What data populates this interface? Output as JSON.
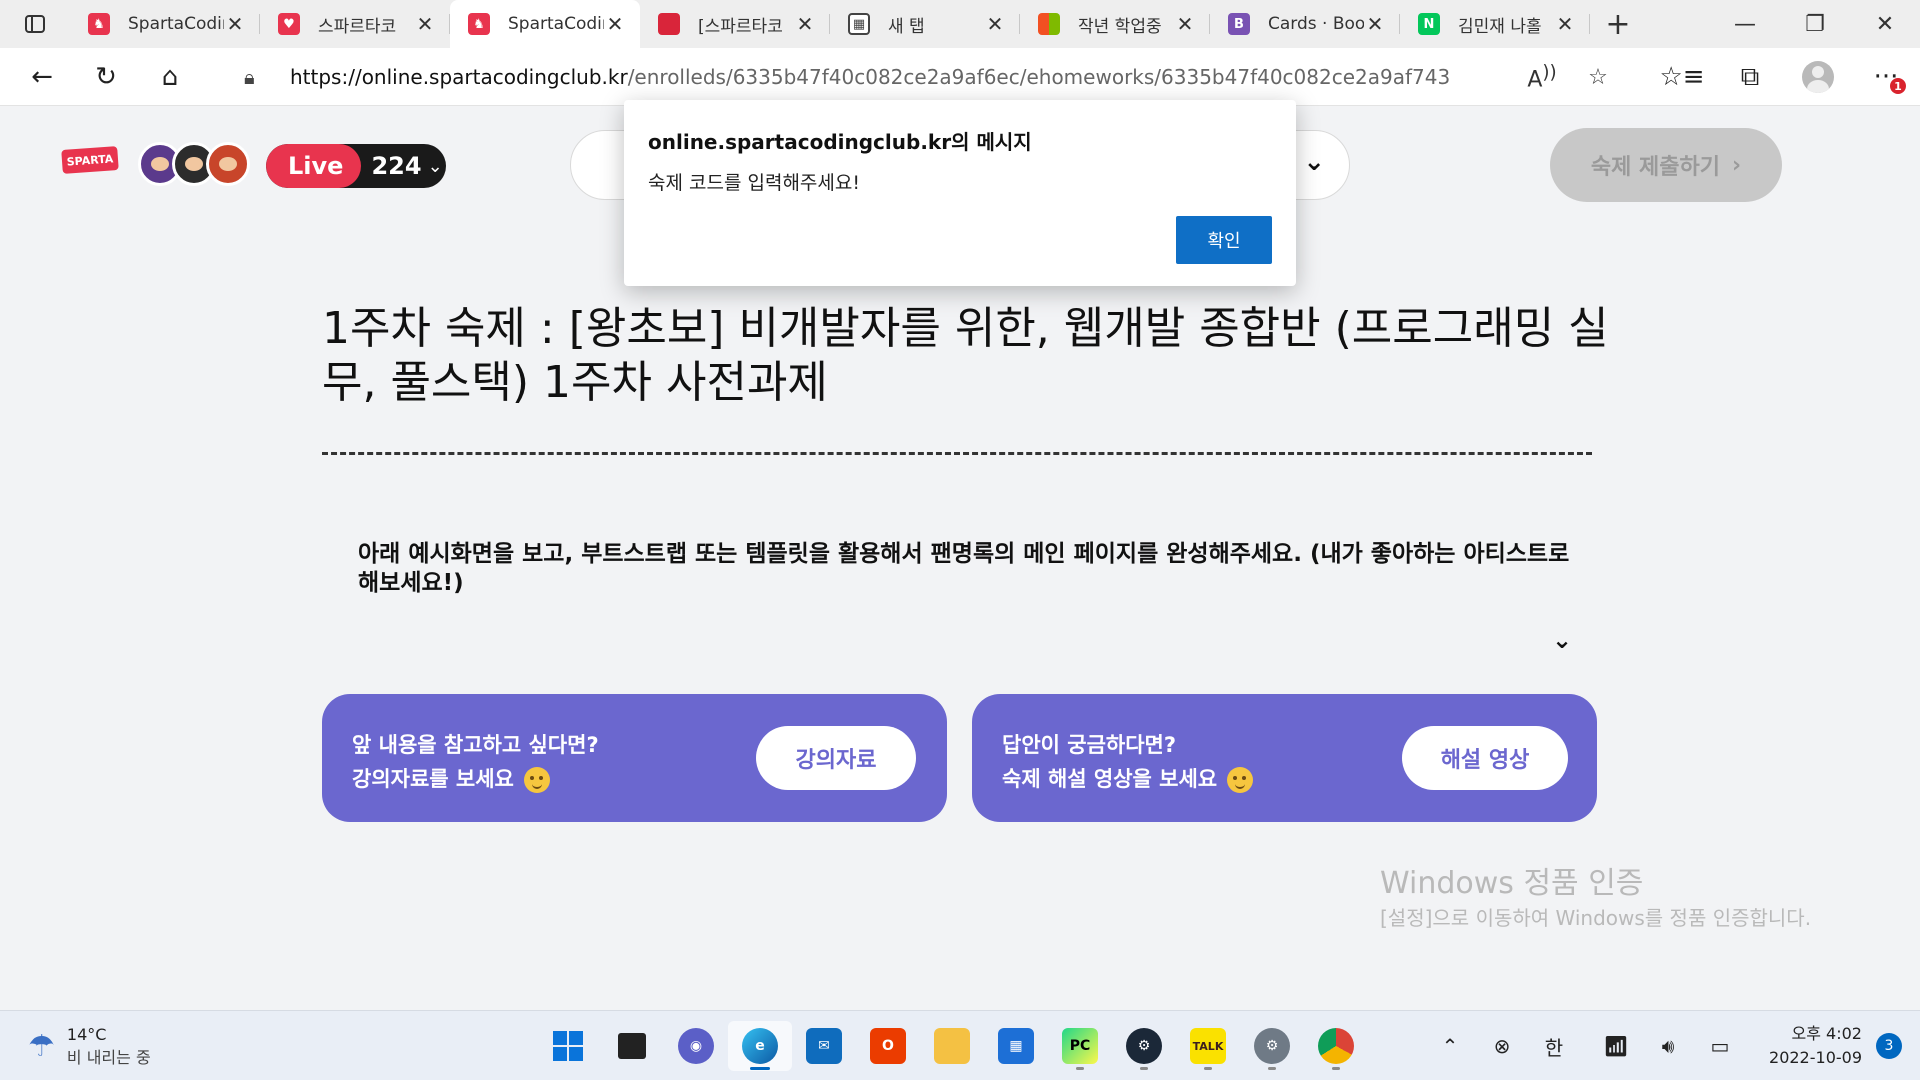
{
  "browser": {
    "tabs": [
      {
        "title": "SpartaCodin",
        "icon": "sparta-icon",
        "color": "#e8344e"
      },
      {
        "title": "스파르타코",
        "icon": "heart-logo-icon",
        "color": "#e8344e"
      },
      {
        "title": "SpartaCodin",
        "icon": "sparta-icon",
        "color": "#e8344e",
        "active": true
      },
      {
        "title": "[스파르타코",
        "icon": "notebook-icon",
        "color": "#d9253a"
      },
      {
        "title": "새 탭",
        "icon": "newtab-icon",
        "color": "#444444"
      },
      {
        "title": "작년 학업중",
        "icon": "microsoft-icon",
        "color": "#f25022"
      },
      {
        "title": "Cards · Boo",
        "icon": "bootstrap-icon",
        "color": "#7952b3"
      },
      {
        "title": "김민재 나홀",
        "icon": "naver-icon",
        "color": "#03c75a"
      }
    ],
    "url_host": "https://online.spartacodingclub.kr",
    "url_path": "/enrolleds/6335b47f40c082ce2a9af6ec/ehomeworks/6335b47f40c082ce2a9af743",
    "profile_badge": "1"
  },
  "page": {
    "logo_text": "SPARTA",
    "live": {
      "label": "Live",
      "count": "224"
    },
    "submit_label": "숙제 제출하기",
    "title": "1주차 숙제 : [왕초보] 비개발자를 위한, 웹개발 종합반 (프로그래밍 실무, 풀스택) 1주차 사전과제",
    "instruction": "아래 예시화면을 보고, 부트스트랩 또는 템플릿을 활용해서 팬명록의 메인 페이지를 완성해주세요. (내가 좋아하는 아티스트로 해보세요!)",
    "cards": [
      {
        "line1": "앞 내용을 참고하고 싶다면?",
        "line2": "강의자료를 보세요",
        "button": "강의자료"
      },
      {
        "line1": "답안이 궁금하다면?",
        "line2": "숙제 해설 영상을 보세요",
        "button": "해설 영상"
      }
    ],
    "accent_color": "#6b67cf"
  },
  "watermark": {
    "title": "Windows 정품 인증",
    "subtitle": "[설정]으로 이동하여 Windows를 정품 인증합니다."
  },
  "dialog": {
    "title": "online.spartacodingclub.kr의 메시지",
    "message": "숙제 코드를 입력해주세요!",
    "ok_label": "확인"
  },
  "taskbar": {
    "weather_temp": "14°C",
    "weather_desc": "비 내리는 중",
    "ime": "한",
    "time": "오후 4:02",
    "date": "2022-10-09",
    "notifications": "3"
  }
}
